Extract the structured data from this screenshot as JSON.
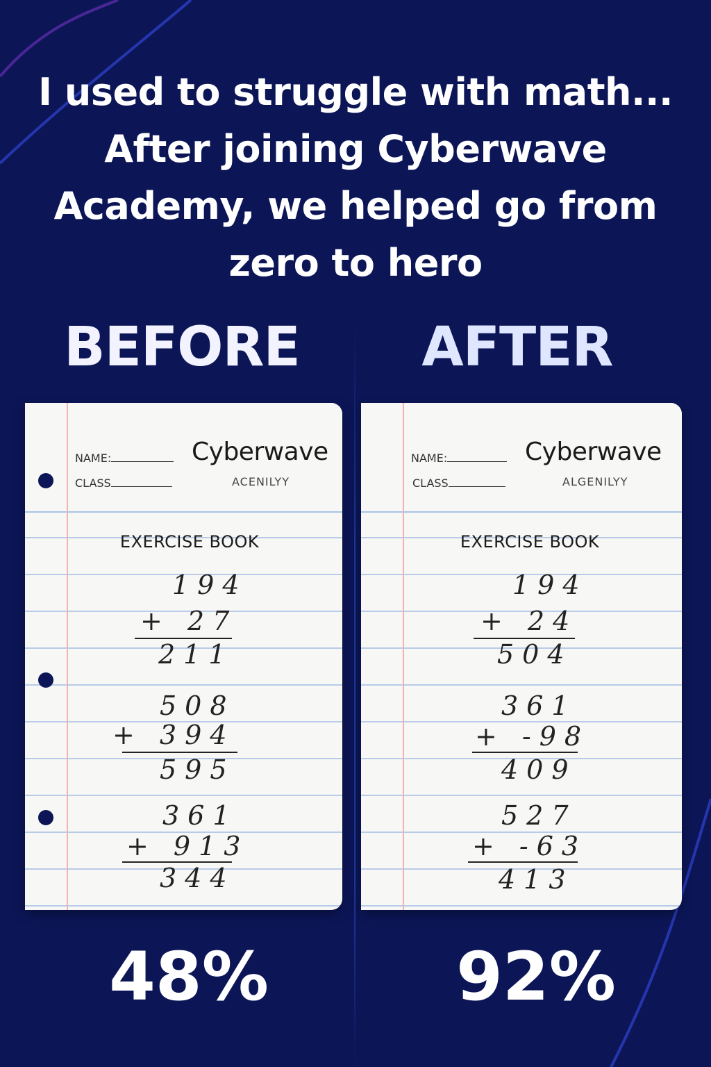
{
  "headline": {
    "line1": "I used to struggle with math...",
    "line2": "After joining Cyberwave",
    "line3": "Academy, we helped go from",
    "line4": "zero to hero"
  },
  "colors": {
    "background": "#0c1657",
    "accent": "#3b4fd1"
  },
  "before": {
    "heading": "BEFORE",
    "name_label": "NAME:",
    "class_label": "CLASS",
    "brand": "Cyberwave",
    "brand_sub": "ACENILYY",
    "book_title": "EXERCISE BOOK",
    "problems": [
      {
        "top": "194",
        "addend": "+ 27",
        "result": "211"
      },
      {
        "top": "508",
        "addend": "+ 394",
        "result": "595"
      },
      {
        "top": "361",
        "addend": "+ 913",
        "result": "344"
      }
    ],
    "score": "48%"
  },
  "after": {
    "heading": "AFTER",
    "name_label": "NAME:",
    "class_label": "CLASS",
    "brand": "Cyberwave",
    "brand_sub": "ALGENILYY",
    "book_title": "EXERCISE BOOK",
    "problems": [
      {
        "top": "194",
        "addend": "+ 24",
        "result": "504"
      },
      {
        "top": "361",
        "addend": "+ -98",
        "result": "409"
      },
      {
        "top": "527",
        "addend": "+ -63",
        "result": "413"
      }
    ],
    "score": "92%"
  }
}
